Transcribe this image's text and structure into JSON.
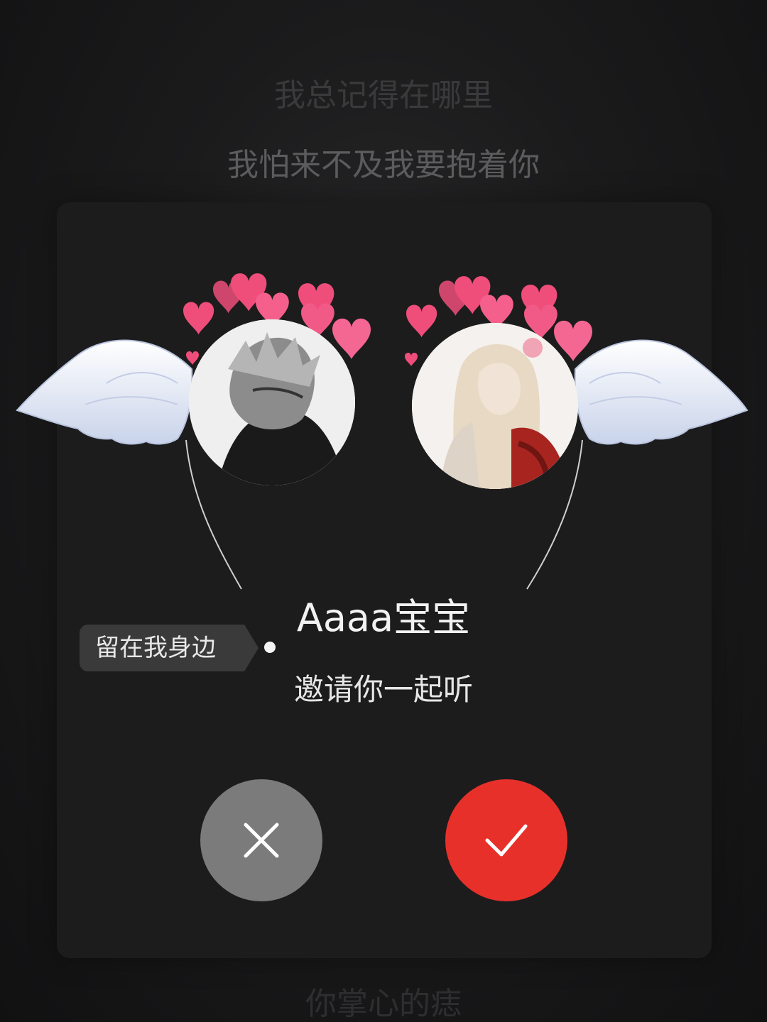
{
  "lyrics": {
    "previous": "我总记得在哪里",
    "current": "我怕来不及我要抱着你",
    "next": "你掌心的痣"
  },
  "invite": {
    "username": "Aaaa宝宝",
    "message": "邀请你一起听",
    "tag": "留在我身边"
  },
  "avatars": {
    "left": "avatar-left",
    "right": "avatar-right"
  },
  "buttons": {
    "decline_icon": "close-icon",
    "accept_icon": "check-icon"
  },
  "colors": {
    "accept": "#e8302b",
    "decline": "#7b7b7b",
    "hearts": "#ef4d7a",
    "wings": "#eef2fb"
  }
}
